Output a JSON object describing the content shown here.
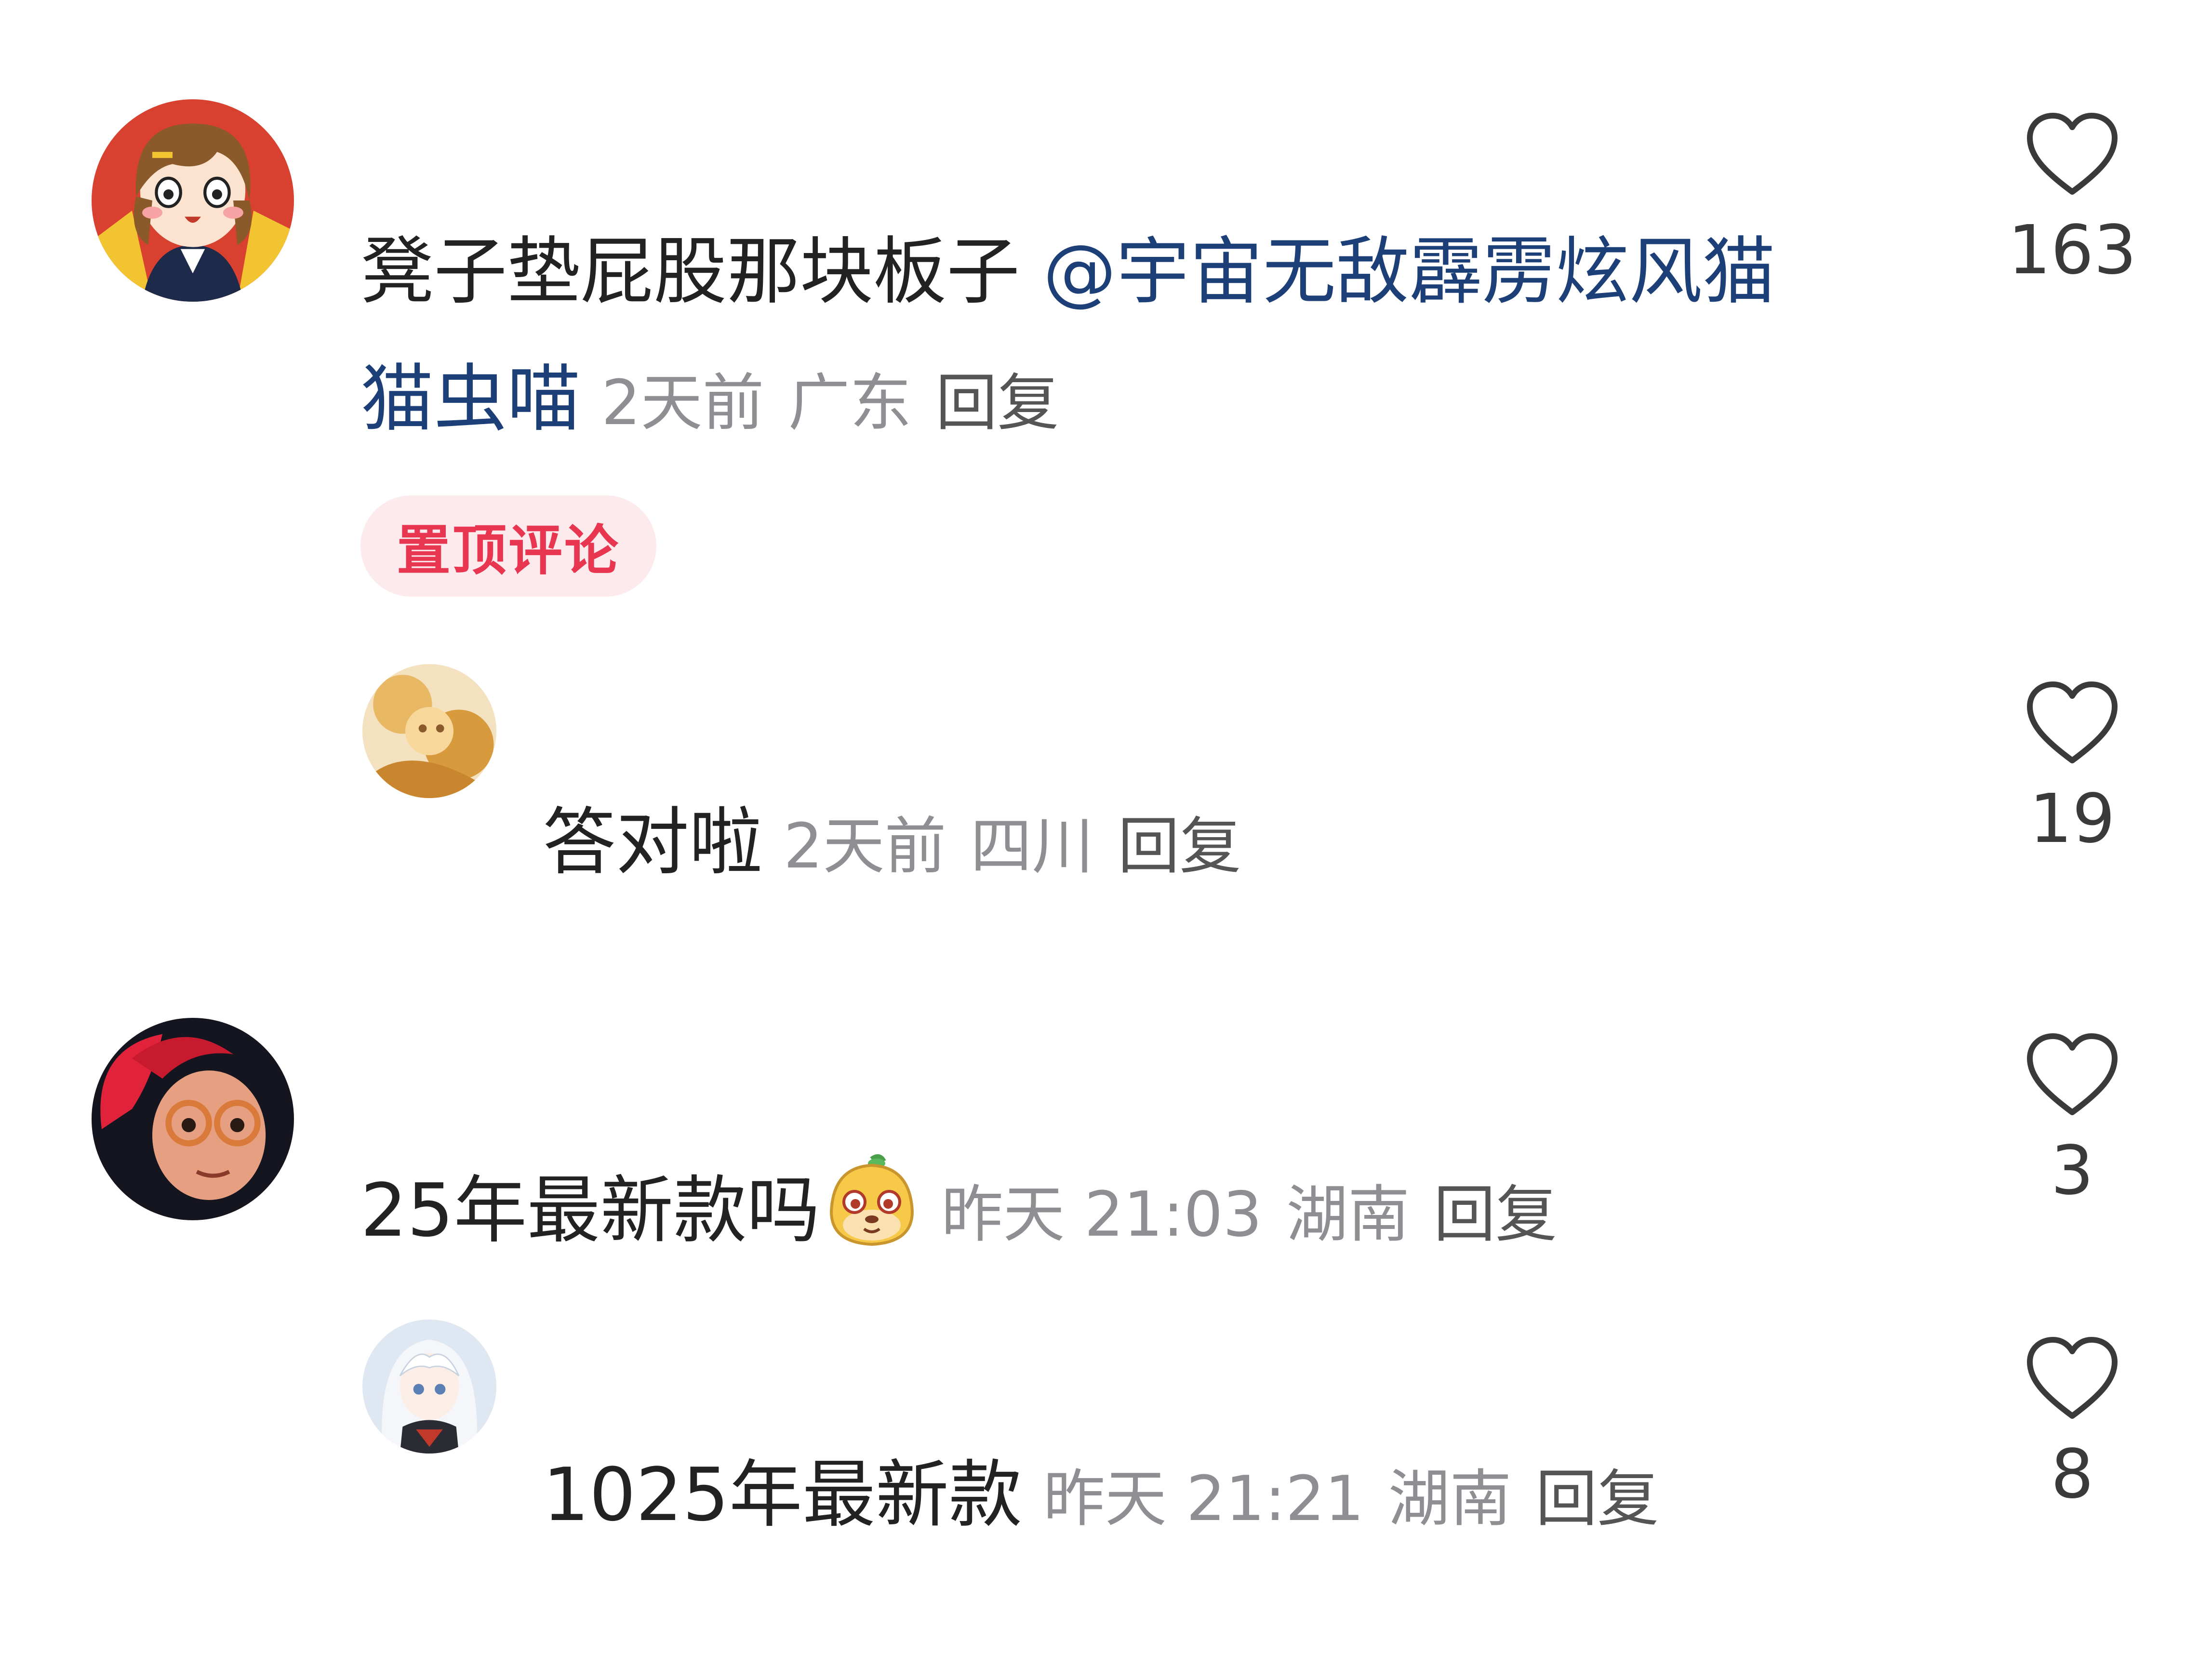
{
  "comments": [
    {
      "text": "凳子垫屁股那块板子 ",
      "mention_line1": "@宇宙无敌霹雳炫风猫",
      "mention_line2": "猫虫喵",
      "time": "2天前",
      "location": "广东",
      "reply": "回复",
      "pinned_badge": "置顶评论",
      "likes": "163",
      "avatar_icon": "anime-girl-brown-hair-avatar"
    },
    {
      "text": "答对啦",
      "time": "2天前",
      "location": "四川",
      "reply": "回复",
      "likes": "19",
      "avatar_icon": "golden-anime-avatar"
    },
    {
      "text": "25年最新款吗",
      "emoji": "smiling-creature-emoji",
      "time": "昨天 21:03",
      "location": "湖南",
      "reply": "回复",
      "likes": "3",
      "avatar_icon": "red-hair-glasses-avatar"
    },
    {
      "text": "1025年最新款",
      "time": "昨天 21:21",
      "location": "湖南",
      "reply": "回复",
      "likes": "8",
      "avatar_icon": "white-hair-anime-avatar"
    }
  ],
  "colors": {
    "mention": "#1c3f78",
    "meta": "#8e8e93",
    "pinned_bg": "#fdeaec",
    "pinned_text": "#e83550"
  }
}
